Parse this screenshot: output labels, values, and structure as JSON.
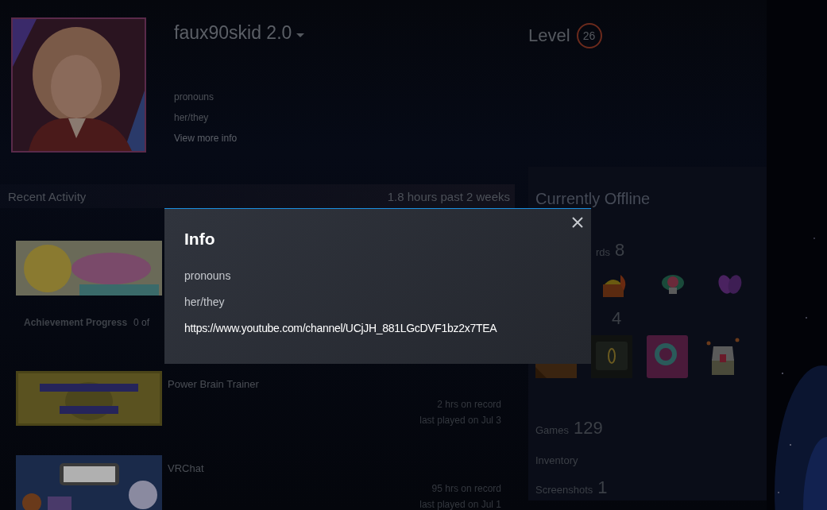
{
  "header": {
    "persona_name": "faux90skid 2.0",
    "level_label": "Level",
    "level": "26",
    "info_lines": [
      "pronouns",
      "her/they"
    ],
    "view_more": "View more info"
  },
  "recent_activity": {
    "title": "Recent Activity",
    "playtime": "1.8 hours past 2 weeks",
    "games": [
      {
        "kind": "achievements",
        "achievement_label": "Achievement Progress",
        "achievement_value": "0 of"
      },
      {
        "kind": "played",
        "name": "Power Brain Trainer",
        "hours": "2 hrs on record",
        "last_played": "last played on Jul 3"
      },
      {
        "kind": "played",
        "name": "VRChat",
        "hours": "95 hrs on record",
        "last_played": "last played on Jul 1"
      }
    ]
  },
  "sidebar": {
    "status": "Currently Offline",
    "awards": {
      "label": "rds",
      "count": "8"
    },
    "badges": {
      "count": "4"
    },
    "counts": [
      {
        "label": "Games",
        "count": "129"
      },
      {
        "label": "Inventory"
      },
      {
        "label": "Screenshots",
        "count": "1"
      }
    ]
  },
  "dialog": {
    "title": "Info",
    "lines": [
      {
        "kind": "text",
        "text": "pronouns"
      },
      {
        "kind": "text",
        "text": "her/they"
      },
      {
        "kind": "link",
        "text": "https://www.youtube.com/channel/UCjJH_881LGcDVF1bz2x7TEA"
      }
    ]
  }
}
